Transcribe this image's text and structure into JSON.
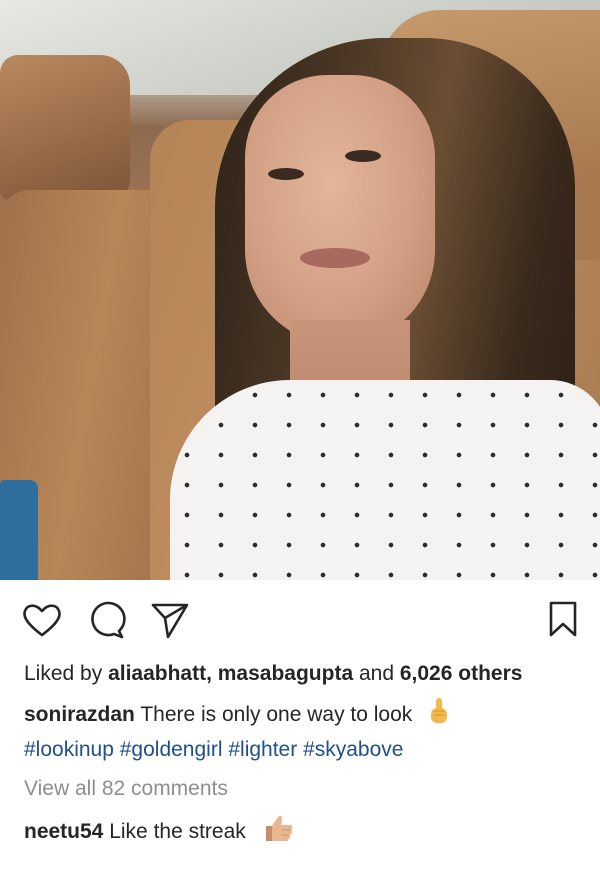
{
  "post": {
    "liked_by_prefix": "Liked by ",
    "liked_by_users": "aliaabhatt, masabagupta",
    "liked_by_and": " and ",
    "liked_by_others": "6,026 others",
    "caption_user": "sonirazdan",
    "caption_text": " There is only one way to look",
    "caption_emoji_icon": "pointing-up-emoji",
    "hashtags": [
      "#lookinup",
      "#goldengirl",
      "#lighter",
      "#skyabove"
    ],
    "view_comments": "View all 82 comments",
    "comment": {
      "user": "neetu54",
      "text": " Like the streak",
      "emoji_icon": "thumbs-up-emoji"
    }
  },
  "colors": {
    "text": "#262626",
    "hashtag": "#1f4f8c",
    "muted": "#8e8e8e"
  },
  "icons": [
    "heart-icon",
    "comment-icon",
    "share-icon",
    "bookmark-icon"
  ]
}
